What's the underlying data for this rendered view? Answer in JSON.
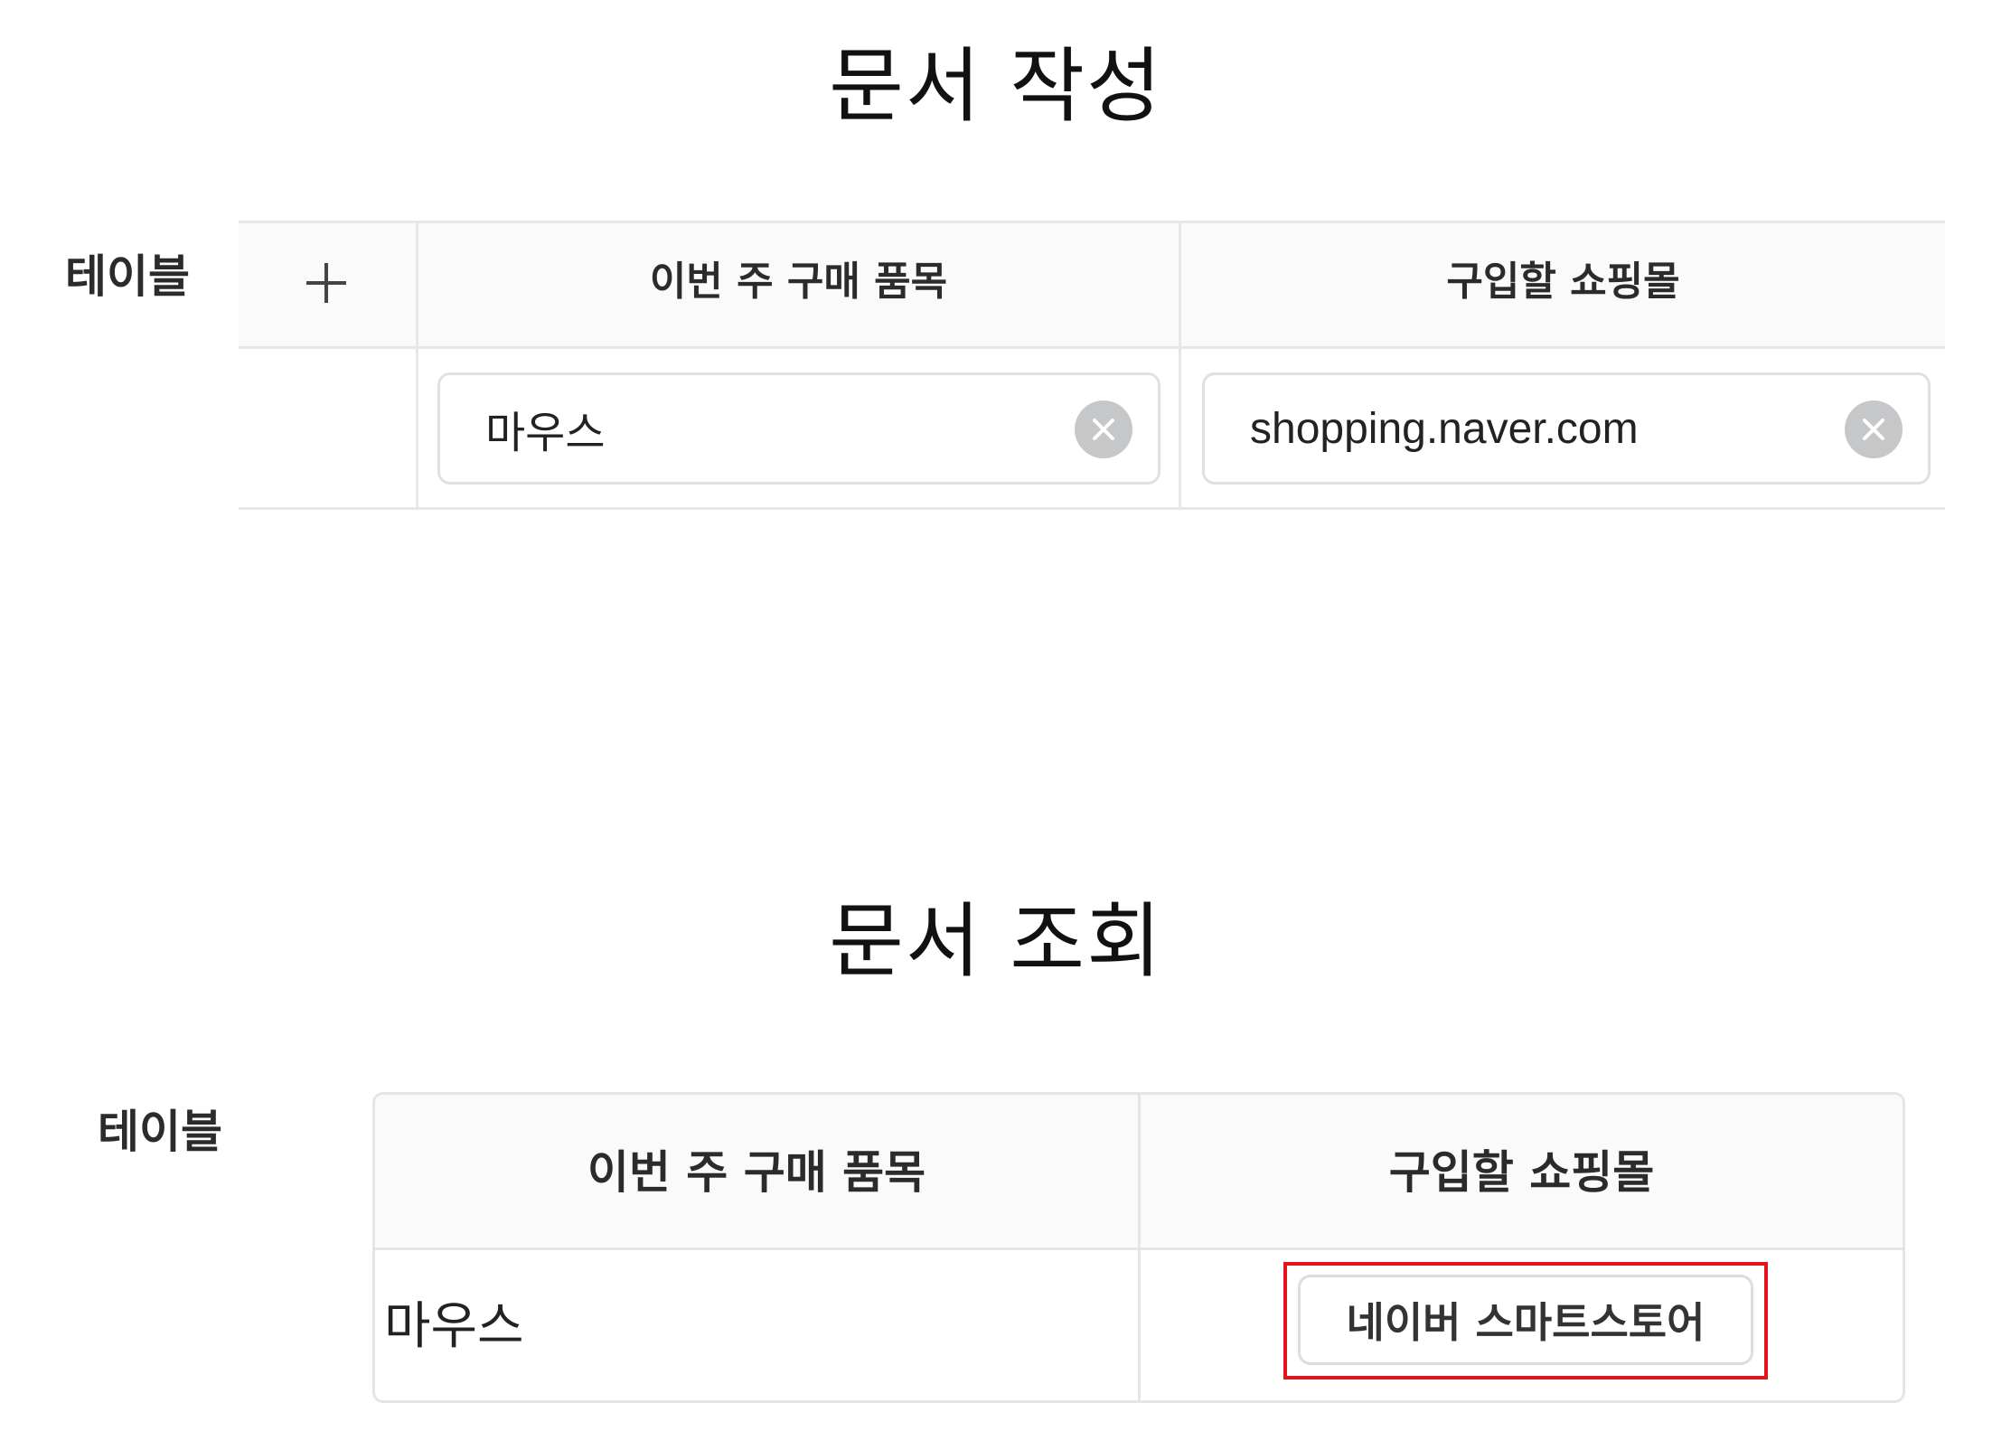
{
  "edit_section": {
    "title": "문서 작성",
    "label": "테이블",
    "columns": [
      "이번 주 구매 품목",
      "구입할 쇼핑몰"
    ],
    "add_icon": "plus-icon",
    "row": {
      "item_value": "마우스",
      "mall_value": "shopping.naver.com",
      "clear_icon": "clear-icon"
    }
  },
  "view_section": {
    "title": "문서 조회",
    "label": "테이블",
    "columns": [
      "이번 주 구매 품목",
      "구입할 쇼핑몰"
    ],
    "row": {
      "item_value": "마우스",
      "mall_button_label": "네이버 스마트스토어"
    },
    "highlight_color": "#e3141b"
  }
}
